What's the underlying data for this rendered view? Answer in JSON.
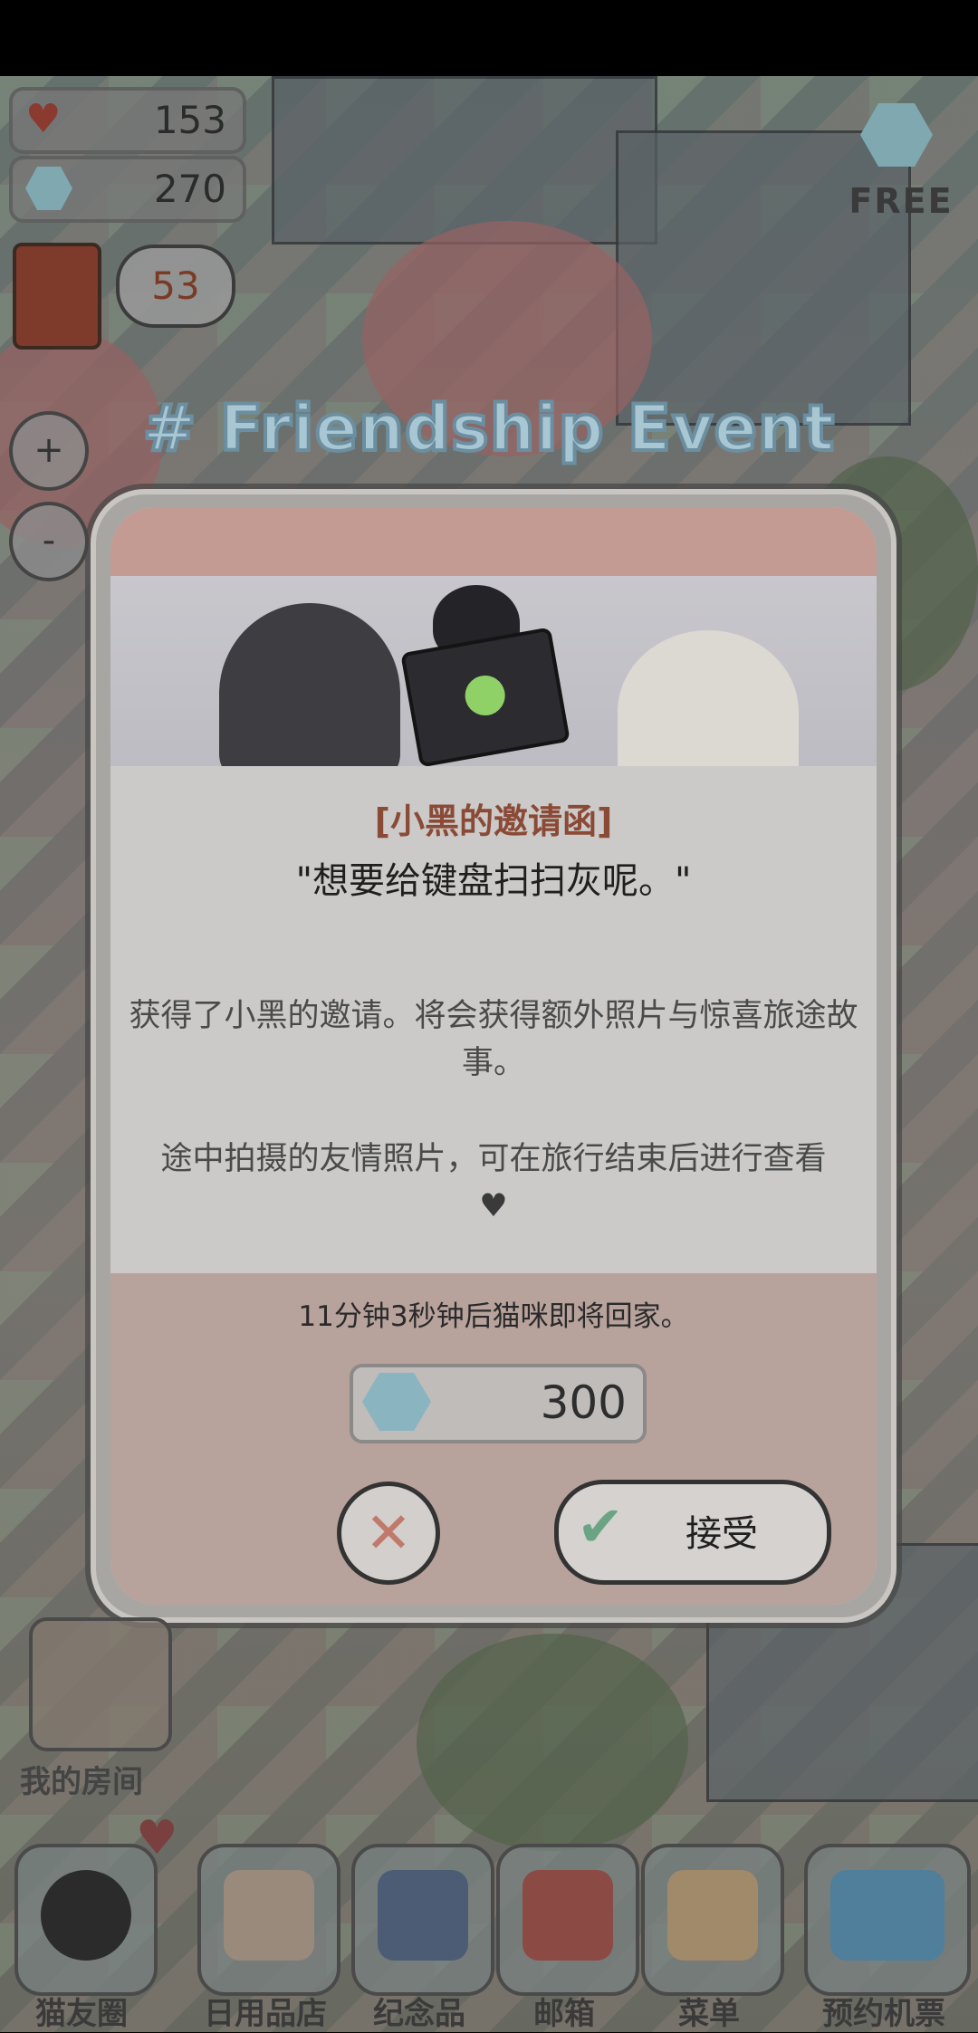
{
  "hud": {
    "hearts": "153",
    "gems": "270",
    "bubble_count": "53",
    "zoom_in": "+",
    "zoom_out": "-",
    "free_label": "FREE"
  },
  "event_title": "# Friendship Event",
  "dialog": {
    "invite_title": "[小黑的邀请函]",
    "quote": "\"想要给键盘扫扫灰呢。\"",
    "description_1": "获得了小黑的邀请。将会获得额外照片与惊喜旅途故事。",
    "description_2": "途中拍摄的友情照片，可在旅行结束后进行查看",
    "heart_glyph": "♥",
    "timer": "11分钟3秒钟后猫咪即将回家。",
    "cost": "300",
    "close_glyph": "✕",
    "check_glyph": "✔",
    "accept_label": "接受"
  },
  "my_room_label": "我的房间",
  "dock": [
    {
      "label": "猫友圈",
      "icon": "cat-profile-icon"
    },
    {
      "label": "日用品店",
      "icon": "shop-icon"
    },
    {
      "label": "纪念品",
      "icon": "souvenir-box-icon"
    },
    {
      "label": "邮箱",
      "icon": "mailbox-icon"
    },
    {
      "label": "菜单",
      "icon": "folder-icon"
    },
    {
      "label": "预约机票",
      "icon": "airplane-icon"
    }
  ],
  "colors": {
    "accent_brown": "#8a4a36",
    "footer": "#b8a29c",
    "modal_header": "#c49b92"
  }
}
